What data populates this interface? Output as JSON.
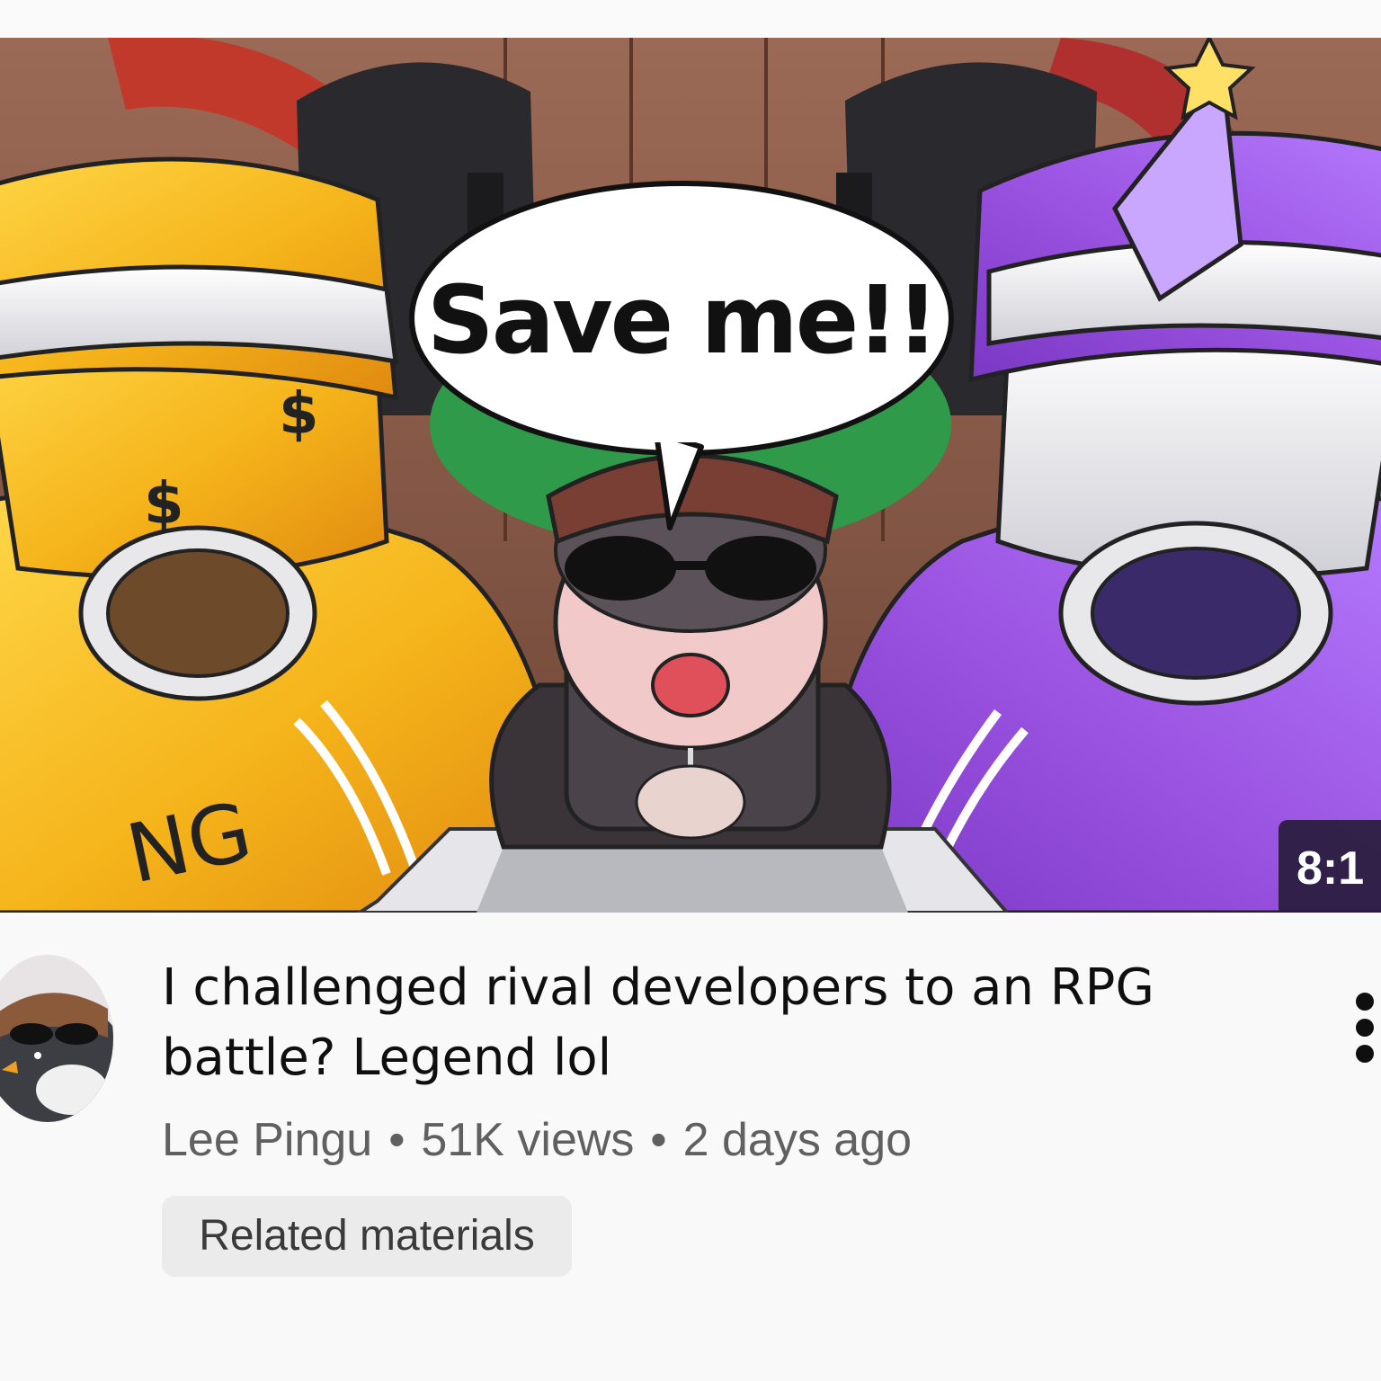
{
  "video": {
    "thumbnail_caption": "Save me!!",
    "thumbnail_lettering": [
      "NG",
      "$",
      "$"
    ],
    "duration": "8:1",
    "title": "I challenged rival developers to an RPG battle? Legend lol",
    "channel": "Lee Pingu",
    "views": "51K views",
    "age": "2 days ago",
    "separator": "•",
    "chip_label": "Related materials"
  },
  "icons": {
    "more": "more-vert-icon"
  },
  "colors": {
    "background": "#f9f9f9",
    "title_text": "#0f0f0f",
    "meta_text": "#606060",
    "chip_background": "#ebebeb",
    "yellow_character": "#f5b41a",
    "purple_character": "#9a52e0",
    "badge_background": "#281c3c"
  }
}
